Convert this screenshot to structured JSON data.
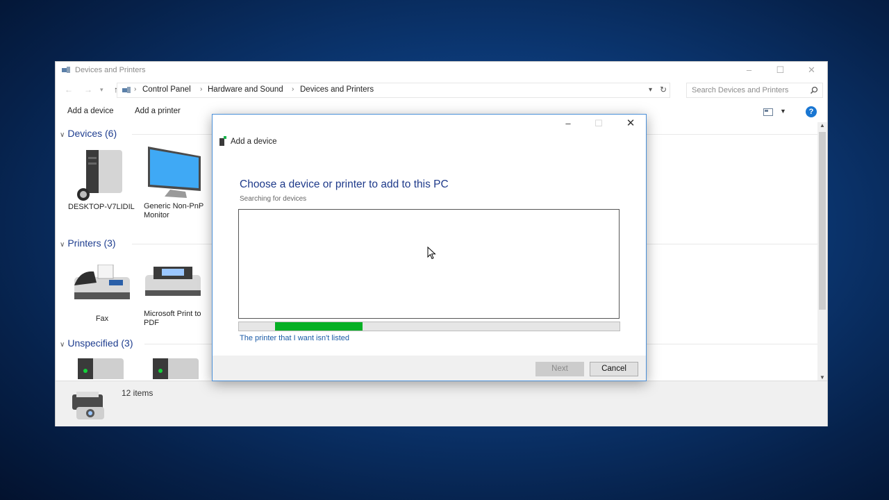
{
  "explorer": {
    "title": "Devices and Printers",
    "breadcrumb": [
      "Control Panel",
      "Hardware and Sound",
      "Devices and Printers"
    ],
    "search_placeholder": "Search Devices and Printers",
    "commands": [
      "Add a device",
      "Add a printer"
    ],
    "groups": [
      {
        "label": "Devices (6)",
        "items": [
          "DESKTOP-V7LIDIL",
          "Generic Non-PnP Monitor"
        ]
      },
      {
        "label": "Printers (3)",
        "items": [
          "Fax",
          "Microsoft Print to PDF"
        ]
      },
      {
        "label": "Unspecified (3)",
        "items": []
      }
    ],
    "status": "12 items"
  },
  "dialog": {
    "title": "Add a device",
    "heading": "Choose a device or printer to add to this PC",
    "status": "Searching for devices",
    "progress": {
      "start": 0.095,
      "end": 0.325
    },
    "link": "The printer that I want isn't listed",
    "next_label": "Next",
    "cancel_label": "Cancel"
  },
  "colors": {
    "accent": "#1e3a8a",
    "progress": "#06b025",
    "link": "#1a5aa6"
  }
}
